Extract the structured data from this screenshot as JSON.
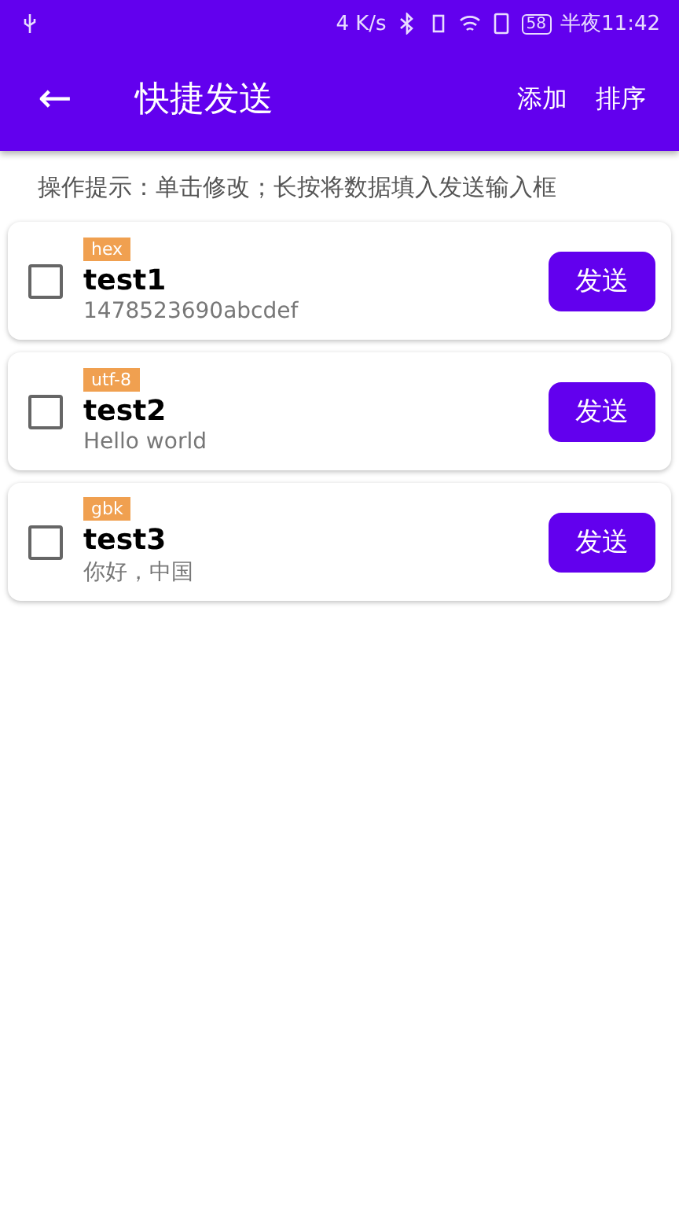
{
  "status_bar": {
    "speed": "4 K/s",
    "battery": "58",
    "time": "半夜11:42"
  },
  "app_bar": {
    "back": "←",
    "title": "快捷发送",
    "actions": [
      "添加",
      "排序"
    ]
  },
  "hint": "操作提示：单击修改；长按将数据填入发送输入框",
  "items": [
    {
      "encoding": "hex",
      "name": "test1",
      "data": "1478523690abcdef",
      "checked": false,
      "button": "发送"
    },
    {
      "encoding": "utf-8",
      "name": "test2",
      "data": "Hello world",
      "checked": false,
      "button": "发送"
    },
    {
      "encoding": "gbk",
      "name": "test3",
      "data": "你好，中国",
      "checked": false,
      "button": "发送"
    }
  ]
}
